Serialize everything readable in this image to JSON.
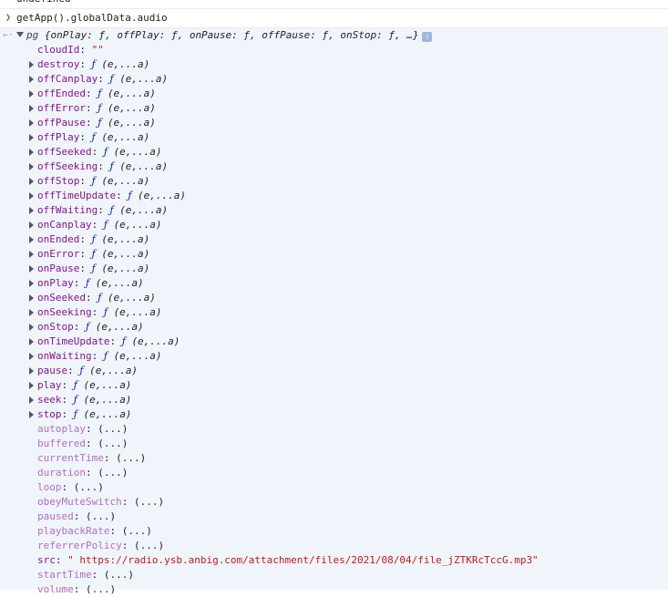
{
  "previous_line": {
    "text": "undefined"
  },
  "command": {
    "text": "getApp().globalData.audio"
  },
  "result": {
    "class_name": "pg",
    "preview": "{onPlay: ƒ, offPlay: ƒ, onPause: ƒ, offPause: ƒ, onStop: ƒ, …}",
    "info_badge": "i",
    "cloudId": {
      "key": "cloudId",
      "value": "\"\""
    },
    "methods": [
      {
        "key": "destroy",
        "f": "ƒ",
        "sig": "(e,...a)"
      },
      {
        "key": "offCanplay",
        "f": "ƒ",
        "sig": "(e,...a)"
      },
      {
        "key": "offEnded",
        "f": "ƒ",
        "sig": "(e,...a)"
      },
      {
        "key": "offError",
        "f": "ƒ",
        "sig": "(e,...a)"
      },
      {
        "key": "offPause",
        "f": "ƒ",
        "sig": "(e,...a)"
      },
      {
        "key": "offPlay",
        "f": "ƒ",
        "sig": "(e,...a)"
      },
      {
        "key": "offSeeked",
        "f": "ƒ",
        "sig": "(e,...a)"
      },
      {
        "key": "offSeeking",
        "f": "ƒ",
        "sig": "(e,...a)"
      },
      {
        "key": "offStop",
        "f": "ƒ",
        "sig": "(e,...a)"
      },
      {
        "key": "offTimeUpdate",
        "f": "ƒ",
        "sig": "(e,...a)"
      },
      {
        "key": "offWaiting",
        "f": "ƒ",
        "sig": "(e,...a)"
      },
      {
        "key": "onCanplay",
        "f": "ƒ",
        "sig": "(e,...a)"
      },
      {
        "key": "onEnded",
        "f": "ƒ",
        "sig": "(e,...a)"
      },
      {
        "key": "onError",
        "f": "ƒ",
        "sig": "(e,...a)"
      },
      {
        "key": "onPause",
        "f": "ƒ",
        "sig": "(e,...a)"
      },
      {
        "key": "onPlay",
        "f": "ƒ",
        "sig": "(e,...a)"
      },
      {
        "key": "onSeeked",
        "f": "ƒ",
        "sig": "(e,...a)"
      },
      {
        "key": "onSeeking",
        "f": "ƒ",
        "sig": "(e,...a)"
      },
      {
        "key": "onStop",
        "f": "ƒ",
        "sig": "(e,...a)"
      },
      {
        "key": "onTimeUpdate",
        "f": "ƒ",
        "sig": "(e,...a)"
      },
      {
        "key": "onWaiting",
        "f": "ƒ",
        "sig": "(e,...a)"
      },
      {
        "key": "pause",
        "f": "ƒ",
        "sig": "(e,...a)"
      },
      {
        "key": "play",
        "f": "ƒ",
        "sig": "(e,...a)"
      },
      {
        "key": "seek",
        "f": "ƒ",
        "sig": "(e,...a)"
      },
      {
        "key": "stop",
        "f": "ƒ",
        "sig": "(e,...a)"
      }
    ],
    "accessors": [
      {
        "key": "autoplay",
        "value": "(...)"
      },
      {
        "key": "buffered",
        "value": "(...)"
      },
      {
        "key": "currentTime",
        "value": "(...)"
      },
      {
        "key": "duration",
        "value": "(...)"
      },
      {
        "key": "loop",
        "value": "(...)"
      },
      {
        "key": "obeyMuteSwitch",
        "value": "(...)"
      },
      {
        "key": "paused",
        "value": "(...)"
      },
      {
        "key": "playbackRate",
        "value": "(...)"
      },
      {
        "key": "referrerPolicy",
        "value": "(...)"
      }
    ],
    "src": {
      "key": "src",
      "value": "\" https://radio.ysb.anbig.com/attachment/files/2021/08/04/file_jZTKRcTccG.mp3\""
    },
    "tail_accessors": [
      {
        "key": "startTime",
        "value": "(...)"
      },
      {
        "key": "volume",
        "value": "(...)"
      }
    ]
  },
  "colors": {
    "key": "#881391",
    "function": "#0d22aa",
    "string": "#c41a16",
    "result_bg": "#f0f4fb"
  }
}
